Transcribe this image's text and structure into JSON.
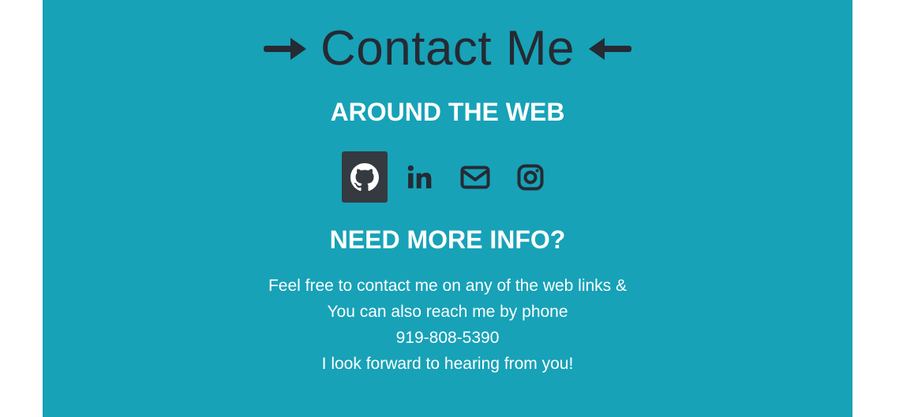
{
  "contact": {
    "title": "Contact Me",
    "around_heading": "AROUND THE WEB",
    "social_links": [
      {
        "icon": "github-icon",
        "label": "GitHub"
      },
      {
        "icon": "linkedin-icon",
        "label": "LinkedIn"
      },
      {
        "icon": "envelope-icon",
        "label": "Email"
      },
      {
        "icon": "instagram-icon",
        "label": "Instagram"
      }
    ],
    "info_heading": "NEED MORE INFO?",
    "info_lines": [
      "Feel free to contact me on any of the web links &",
      "You can also reach me by phone",
      "919-808-5390",
      "I look forward to hearing from you!"
    ]
  },
  "colors": {
    "background": "#17a2b8",
    "dark": "#252a33",
    "active_icon_bg": "#343a40",
    "text_light": "#ffffff"
  }
}
